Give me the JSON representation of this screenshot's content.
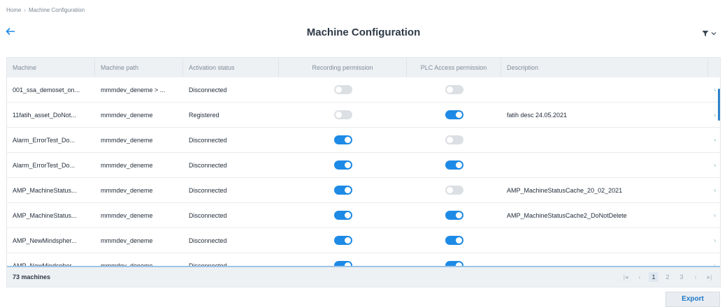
{
  "breadcrumb": {
    "home": "Home",
    "current": "Machine Configuration"
  },
  "header": {
    "title": "Machine Configuration"
  },
  "table": {
    "columns": [
      "Machine",
      "Machine path",
      "Activation status",
      "Recording permission",
      "PLC Access permission",
      "Description"
    ],
    "rows": [
      {
        "machine": "001_ssa_demoset_on...",
        "path": "mmmdev_deneme > ...",
        "status": "Disconnected",
        "recording": false,
        "plc": false,
        "description": ""
      },
      {
        "machine": "11fatih_asset_DoNot...",
        "path": "mmmdev_deneme",
        "status": "Registered",
        "recording": false,
        "plc": true,
        "description": "fatih desc 24.05.2021"
      },
      {
        "machine": "Alarm_ErrorTest_Do...",
        "path": "mmmdev_deneme",
        "status": "Disconnected",
        "recording": true,
        "plc": false,
        "description": ""
      },
      {
        "machine": "Alarm_ErrorTest_Do...",
        "path": "mmmdev_deneme",
        "status": "Disconnected",
        "recording": true,
        "plc": true,
        "description": ""
      },
      {
        "machine": "AMP_MachineStatus...",
        "path": "mmmdev_deneme",
        "status": "Disconnected",
        "recording": true,
        "plc": false,
        "description": "AMP_MachineStatusCache_20_02_2021"
      },
      {
        "machine": "AMP_MachineStatus...",
        "path": "mmmdev_deneme",
        "status": "Disconnected",
        "recording": true,
        "plc": true,
        "description": "AMP_MachineStatusCache2_DoNotDelete"
      },
      {
        "machine": "AMP_NewMindspher...",
        "path": "mmmdev_deneme",
        "status": "Disconnected",
        "recording": true,
        "plc": true,
        "description": ""
      },
      {
        "machine": "AMP_NewMindspher...",
        "path": "mmmdev_deneme",
        "status": "Disconnected",
        "recording": true,
        "plc": true,
        "description": ""
      }
    ]
  },
  "footer": {
    "count": "73 machines",
    "pages": [
      "1",
      "2",
      "3"
    ],
    "current_page": "1"
  },
  "actions": {
    "export_label": "Export"
  },
  "colors": {
    "accent": "#1d8ae6",
    "toggle_off": "#dcdfe3",
    "header_bg": "#eef1f4"
  },
  "icons": {
    "back": "arrow-left-icon",
    "filter": "filter-icon",
    "row_action": "machine-config-icon"
  }
}
